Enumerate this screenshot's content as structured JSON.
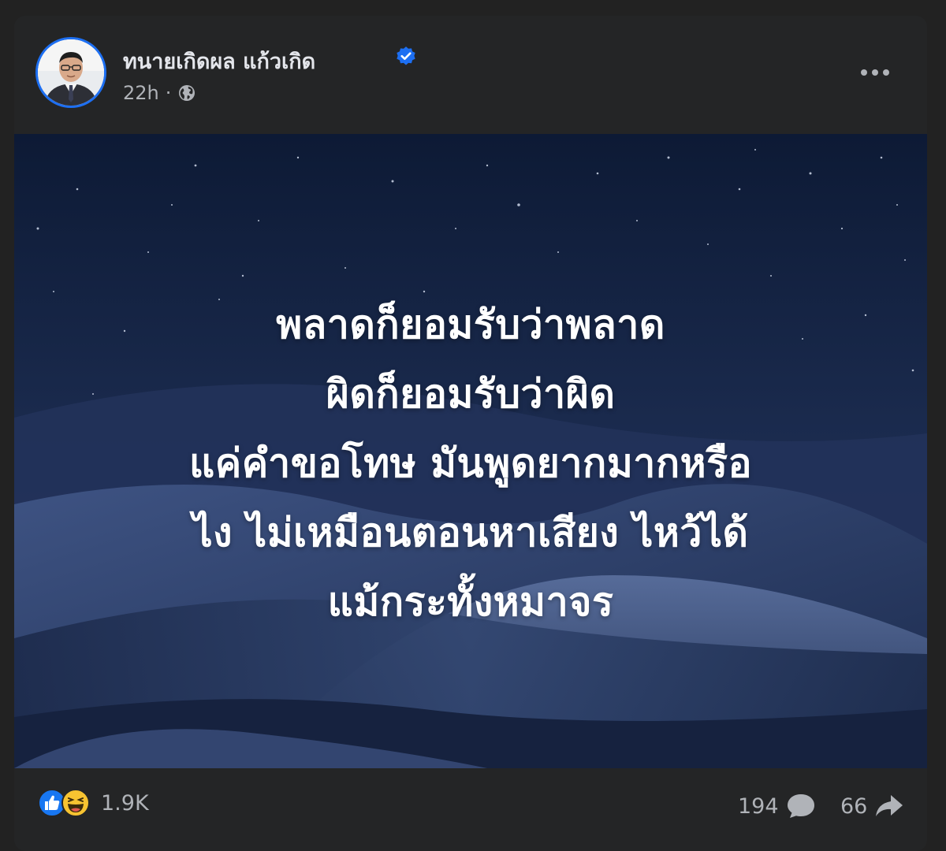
{
  "post": {
    "author_name": "ทนายเกิดผล แก้วเกิด",
    "verified": true,
    "time": "22h",
    "separator": "·",
    "audience_icon": "globe-icon",
    "more_icon": "more-horizontal-icon"
  },
  "image": {
    "quote_lines": [
      "พลาดก็ยอมรับว่าพลาด",
      "ผิดก็ยอมรับว่าผิด",
      "แค่คำขอโทษ มันพูดยากมากหรือ",
      "ไง ไม่เหมือนตอนหาเสียง ไหว้ได้",
      "แม้กระทั้งหมาจร"
    ]
  },
  "footer": {
    "reaction_icons": [
      "like-icon",
      "haha-icon"
    ],
    "reaction_count": "1.9K",
    "comment_count": "194",
    "comment_icon": "comment-icon",
    "share_count": "66",
    "share_icon": "share-icon"
  },
  "colors": {
    "card_bg": "#242526",
    "page_bg": "#222222",
    "text_primary": "#e4e6eb",
    "text_secondary": "#b0b3b8",
    "verified_blue": "#1d6ff2",
    "like_blue": "#1877f2",
    "haha_yellow": "#f7c331"
  }
}
